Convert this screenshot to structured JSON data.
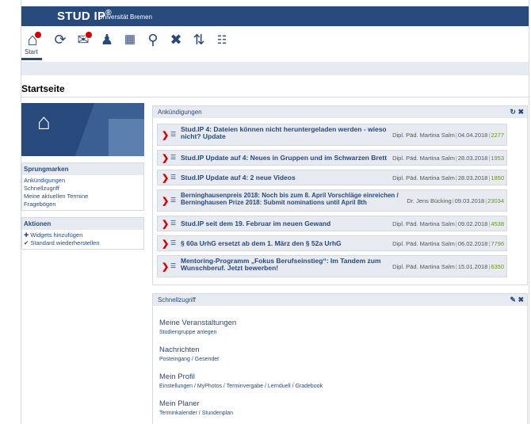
{
  "header": {
    "logo": "STUD IP",
    "logo_mark": "®",
    "university": "Universität Bremen"
  },
  "nav": {
    "start_label": "Start"
  },
  "page": {
    "title": "Startseite"
  },
  "sidebar": {
    "jump_heading": "Sprungmarken",
    "jump_items": [
      "Ankündigungen",
      "Schnellzugriff",
      "Meine aktuellen Termine",
      "Fragebögen"
    ],
    "actions_heading": "Aktionen",
    "actions": [
      {
        "icon": "plus-icon",
        "label": "Widgets hinzufügen"
      },
      {
        "icon": "checkmark-icon",
        "label": "Standard wiederherstellen"
      }
    ]
  },
  "announcements": {
    "heading": "Ankündigungen",
    "items": [
      {
        "title": "Stud.IP 4: Dateien können nicht heruntergeladen werden - wieso nicht? Update",
        "author": "Dipl. Päd. Martina Salm",
        "date": "04.04.2018",
        "views": "2277"
      },
      {
        "title": "Stud.IP Update auf 4: Neues in Gruppen und im Schwarzen Brett",
        "author": "Dipl. Päd. Martina Salm",
        "date": "28.03.2018",
        "views": "1953"
      },
      {
        "title": "Stud.IP Update auf 4: 2 neue Videos",
        "author": "Dipl. Päd. Martina Salm",
        "date": "28.03.2018",
        "views": "1850"
      },
      {
        "title": "Berninghausenpreis 2018: Noch bis zum 8. April Vorschläge einreichen / Berninghausen Prize 2018: Submit nominations until April 8th",
        "author": "Dr. Jens Bücking",
        "date": "09.03.2018",
        "views": "23034"
      },
      {
        "title": "Stud.IP seit dem 19. Februar im neuen Gewand",
        "author": "Dipl. Päd. Martina Salm",
        "date": "09.02.2018",
        "views": "4538"
      },
      {
        "title": "§ 60a UrhG ersetzt ab dem 1. März den § 52a UrhG",
        "author": "Dipl. Päd. Martina Salm",
        "date": "06.02.2018",
        "views": "7796"
      },
      {
        "title": "Mentoring-Programm „Fokus Berufseinstieg“: Im Tandem zum Wunschberuf. Jetzt bewerben!",
        "author": "Dipl. Päd. Martina Salm",
        "date": "15.01.2018",
        "views": "6350"
      }
    ]
  },
  "quickaccess": {
    "heading": "Schnellzugriff",
    "items": [
      {
        "title": "Meine Veranstaltungen",
        "sub": "Studiengruppe anlegen"
      },
      {
        "title": "Nachrichten",
        "sub": "Posteingang / Gesendet"
      },
      {
        "title": "Mein Profil",
        "sub": "Einstellungen / MyPhotos / Terminvergabe / Lernduell / Gradebook"
      },
      {
        "title": "Mein Planer",
        "sub": "Terminkalender / Stundenplan"
      }
    ]
  },
  "colors": {
    "brand": "#28497c",
    "badge": "#d60000",
    "count": "#6a8f2c"
  }
}
